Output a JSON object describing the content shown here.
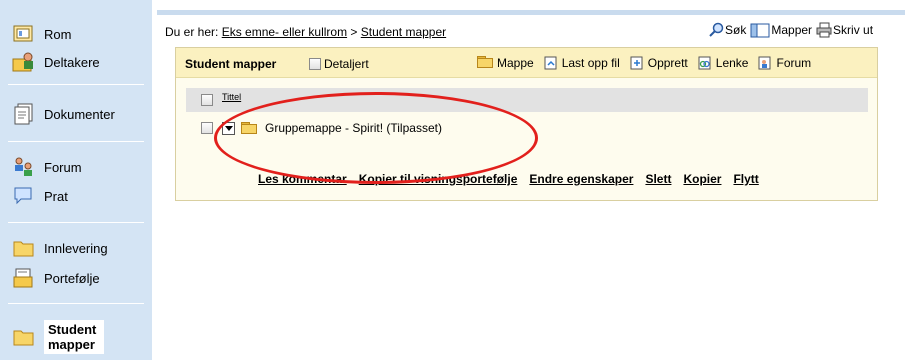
{
  "sidebar": {
    "items": [
      {
        "label": "Rom",
        "icon": "room-icon"
      },
      {
        "label": "Deltakere",
        "icon": "participants-icon"
      },
      {
        "label": "Dokumenter",
        "icon": "documents-icon"
      },
      {
        "label": "Forum",
        "icon": "forum-icon"
      },
      {
        "label": "Prat",
        "icon": "chat-icon"
      },
      {
        "label": "Innlevering",
        "icon": "submission-folder-icon"
      },
      {
        "label": "Portefølje",
        "icon": "portfolio-icon"
      },
      {
        "label": "Student mapper",
        "icon": "student-folder-icon"
      }
    ]
  },
  "header": {
    "breadcrumb_prefix": "Du er her: ",
    "breadcrumb_room": "Eks emne- eller kullrom",
    "breadcrumb_separator": " > ",
    "breadcrumb_current": "Student mapper",
    "search_label": "Søk",
    "folders_label": "Mapper",
    "print_label": "Skriv ut"
  },
  "panel": {
    "title": "Student mapper",
    "detail_label": "Detaljert",
    "actions": {
      "folder": "Mappe",
      "upload": "Last opp fil",
      "create": "Opprett",
      "link": "Lenke",
      "forum": "Forum"
    },
    "column_title": "Tittel",
    "item_name": "Gruppemappe - Spirit! (Tilpasset)",
    "bottom_links": {
      "comments": "Les kommentar",
      "copy_to_portfolio": "Kopier til visningsportefølje",
      "edit_properties": "Endre egenskaper",
      "delete": "Slett",
      "copy": "Kopier",
      "move": "Flytt"
    }
  },
  "colors": {
    "sidebar_bg": "#d4e4f4",
    "panel_header_bg": "#fbf1c0",
    "annotation_ellipse": "#e2201c"
  }
}
